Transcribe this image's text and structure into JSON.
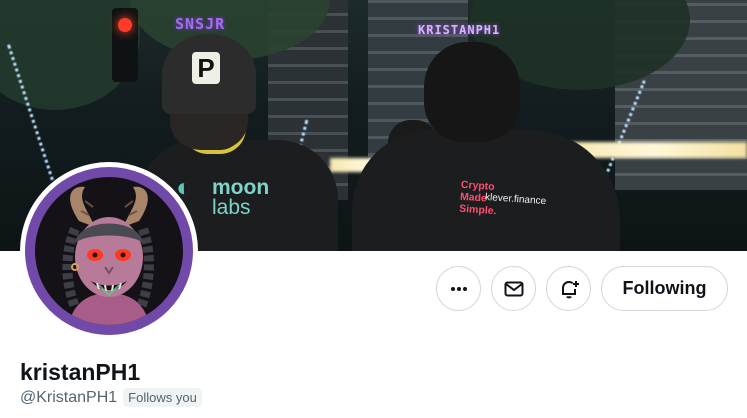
{
  "banner": {
    "overlay_tag_left": "SNSJR",
    "overlay_tag_right": "KRISTANPH1",
    "cap_letter": "P",
    "shirt_left_logo": "moon labs",
    "shirt_left_logo_line1": "moon",
    "shirt_left_logo_line2": "labs",
    "shirt_right_line1": "Crypto Made Simple.",
    "shirt_right_line2": "klever.finance",
    "colors": {
      "tag_left": "#a66bf0",
      "tag_right": "#d8b3ff",
      "shirt_text": "#ff4d6d"
    }
  },
  "avatar": {
    "icon": "demon-avatar-icon",
    "ring_color": "#7149a8"
  },
  "actions": {
    "more_icon": "more-icon",
    "message_icon": "mail-icon",
    "notify_icon": "bell-plus-icon",
    "following_label": "Following"
  },
  "profile": {
    "display_name": "kristanPH1",
    "handle": "@KristanPH1",
    "follows_you": "Follows you"
  }
}
